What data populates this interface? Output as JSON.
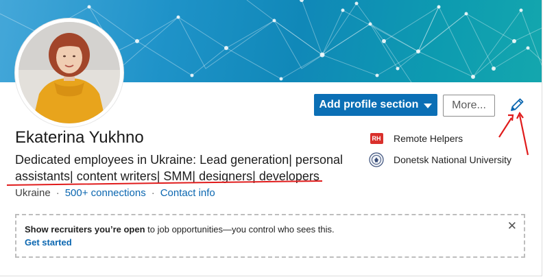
{
  "profile": {
    "name": "Ekaterina Yukhno",
    "headline": "Dedicated employees in Ukraine: Lead generation| personal assistants| content writers| SMM| designers| developers",
    "location": "Ukraine",
    "separator": "·",
    "connections": "500+ connections",
    "contact_info": "Contact info"
  },
  "actions": {
    "add_section_label": "Add profile section",
    "more_label": "More..."
  },
  "sidebar": {
    "items": [
      {
        "label": "Remote Helpers",
        "logo_text": "RH",
        "icon": "company-logo"
      },
      {
        "label": "Donetsk National University",
        "icon": "university-seal"
      }
    ]
  },
  "open_to_work": {
    "text_bold": "Show recruiters you’re open",
    "text_rest": " to job opportunities—you control who sees this.",
    "link": "Get started",
    "close": "✕"
  },
  "colors": {
    "primary": "#0b6fb5",
    "link": "#0a66b0",
    "annotation": "#e01b1b"
  },
  "icons": {
    "edit": "pencil-icon",
    "dropdown": "caret-down-icon",
    "close": "close-icon"
  }
}
